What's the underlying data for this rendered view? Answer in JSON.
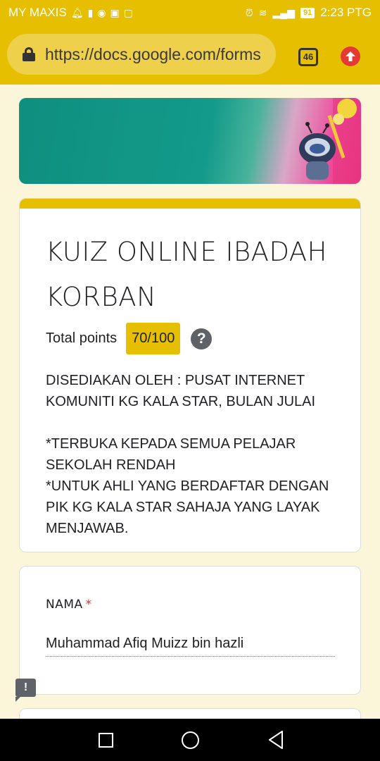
{
  "status_bar": {
    "carrier": "MY MAXIS",
    "battery": "91",
    "time": "2:23 PTG"
  },
  "browser": {
    "url": "https://docs.google.com/forms",
    "tab_count": "46"
  },
  "form": {
    "title": "KUIZ ONLINE IBADAH KORBAN",
    "points_label": "Total points",
    "score": "70/100",
    "help": "?",
    "description": {
      "line1": "DISEDIAKAN OLEH : PUSAT INTERNET KOMUNITI KG KALA STAR, BULAN JULAI",
      "line2": "*TERBUKA KEPADA SEMUA PELAJAR SEKOLAH RENDAH",
      "line3": "*UNTUK AHLI YANG BERDAFTAR DENGAN PIK KG KALA STAR SAHAJA YANG LAYAK MENJAWAB."
    }
  },
  "question": {
    "label": "NAMA",
    "required_mark": "*",
    "answer": "Muhammad Afiq Muizz bin hazli"
  },
  "report": {
    "symbol": "!"
  },
  "colors": {
    "theme": "#e6bf00",
    "background": "#fbf5d9",
    "required": "#d93025"
  }
}
